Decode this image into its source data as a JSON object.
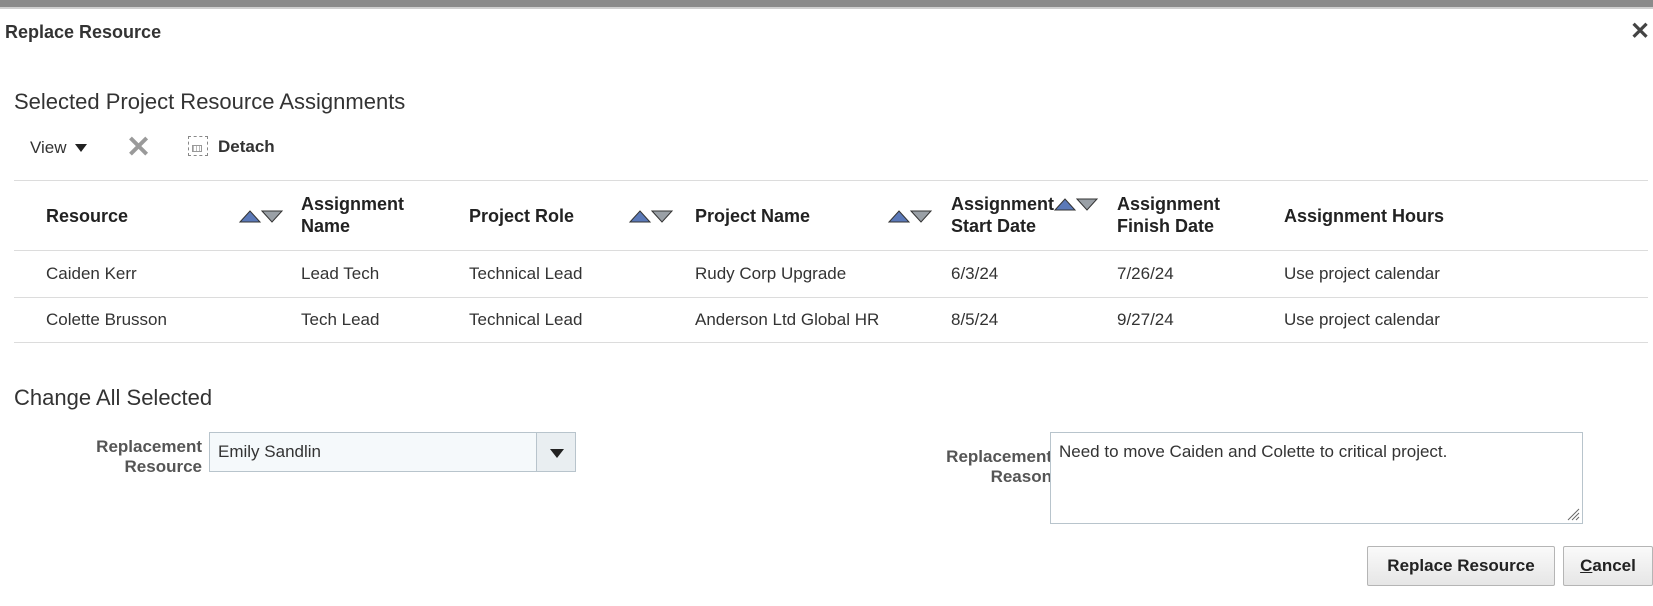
{
  "dialog": {
    "title": "Replace Resource"
  },
  "selected_section": {
    "heading": "Selected Project Resource Assignments",
    "toolbar": {
      "view_label": "View",
      "detach_label": "Detach"
    },
    "columns": [
      "Resource",
      "Assignment Name",
      "Project Role",
      "Project Name",
      "Assignment Start Date",
      "Assignment Finish Date",
      "Assignment Hours"
    ],
    "rows": [
      [
        "Caiden Kerr",
        "Lead Tech",
        "Technical Lead",
        "Rudy Corp Upgrade",
        "6/3/24",
        "7/26/24",
        "Use project calendar"
      ],
      [
        "Colette Brusson",
        "Tech Lead",
        "Technical Lead",
        "Anderson Ltd Global HR",
        "8/5/24",
        "9/27/24",
        "Use project calendar"
      ]
    ]
  },
  "change_section": {
    "heading": "Change All Selected",
    "replacement_resource": {
      "label": "Replacement Resource",
      "value": "Emily Sandlin"
    },
    "replacement_reason": {
      "label": "Replacement Reason",
      "value": "Need to move Caiden and Colette to critical project."
    }
  },
  "buttons": {
    "replace": "Replace Resource",
    "cancel_mnemonic": "C",
    "cancel_rest": "ancel"
  },
  "colors": {
    "sort_active": "#5b79b8",
    "sort_inactive": "#9aa0a6",
    "delete_icon": "#9a9a9a"
  },
  "icons": [
    "close-icon",
    "view-dropdown-icon",
    "delete-icon",
    "detach-icon",
    "sort-ascending-icon",
    "sort-descending-icon",
    "dropdown-arrow-icon",
    "resize-grip-icon"
  ]
}
